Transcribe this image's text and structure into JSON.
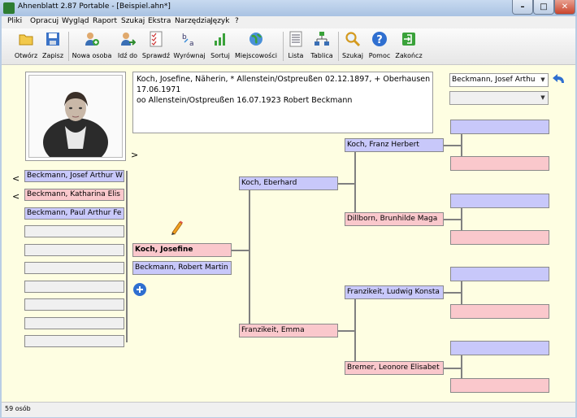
{
  "window": {
    "title": "Ahnenblatt 2.87 Portable - [Beispiel.ahn*]",
    "minimize": "–",
    "maximize": "□",
    "close": "✕"
  },
  "menu": [
    "Pliki",
    "Opracuj",
    "Wygląd",
    "Raport",
    "Szukaj",
    "Ekstra",
    "Narzędzia",
    "Język",
    "?"
  ],
  "toolbar": [
    {
      "label": "Otwórz",
      "icon": "open-folder-icon"
    },
    {
      "label": "Zapisz",
      "icon": "save-icon"
    },
    {
      "label": "Nowa osoba",
      "icon": "new-person-icon"
    },
    {
      "label": "Idź do",
      "icon": "go-to-person-icon"
    },
    {
      "label": "Sprawdź",
      "icon": "check-icon"
    },
    {
      "label": "Wyrównaj",
      "icon": "align-icon"
    },
    {
      "label": "Sortuj",
      "icon": "sort-icon"
    },
    {
      "label": "Miejscowości",
      "icon": "globe-icon"
    },
    {
      "label": "Lista",
      "icon": "list-icon"
    },
    {
      "label": "Tablica",
      "icon": "table-icon"
    },
    {
      "label": "Szukaj",
      "icon": "search-icon"
    },
    {
      "label": "Pomoc",
      "icon": "help-icon"
    },
    {
      "label": "Zakończ",
      "icon": "exit-icon"
    }
  ],
  "info": {
    "line1": "Koch, Josefine, Näherin, * Allenstein/Ostpreußen 02.12.1897, + Oberhausen",
    "line2": "17.06.1971",
    "line3": "oo Allenstein/Ostpreußen 16.07.1923 Robert Beckmann"
  },
  "partner_select": {
    "value": "Beckmann, Josef Arthu"
  },
  "second_select": {
    "value": ""
  },
  "nav": {
    "forward": ">",
    "back1": "<",
    "back2": "<"
  },
  "children": [
    "Beckmann, Josef Arthur W",
    "Beckmann, Katharina Elis",
    "Beckmann, Paul Arthur Fe",
    "",
    "",
    "",
    "",
    "",
    "",
    ""
  ],
  "person": "Koch, Josefine",
  "partner": "Beckmann, Robert Martin",
  "parents": {
    "father": "Koch, Eberhard",
    "mother": "Franzikeit, Emma"
  },
  "grandparents": {
    "paternal_father": "Koch, Franz Herbert",
    "paternal_mother": "Dillborn, Brunhilde Maga",
    "maternal_father": "Franzikeit, Ludwig Konsta",
    "maternal_mother": "Bremer, Leonore Elisabet"
  },
  "status": "59 osób",
  "colors": {
    "male": "#c8c8fa",
    "female": "#fac8cc",
    "background": "#fefee2"
  }
}
